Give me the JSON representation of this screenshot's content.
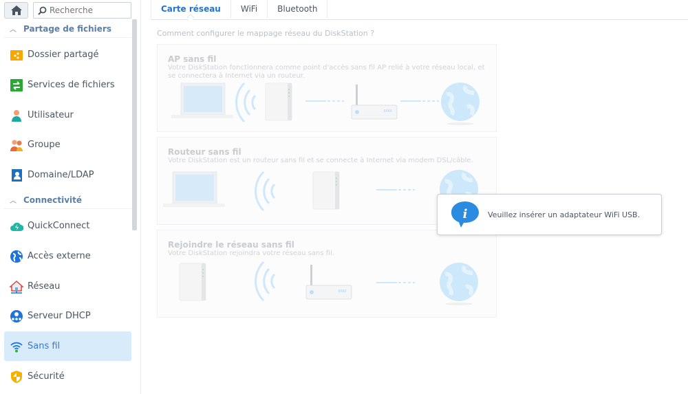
{
  "sidebar": {
    "search_placeholder": "Recherche",
    "sections": [
      {
        "label": "Partage de fichiers"
      },
      {
        "label": "Connectivité"
      }
    ],
    "items": [
      {
        "label": "Dossier partagé",
        "icon": "shared-folder-icon"
      },
      {
        "label": "Services de fichiers",
        "icon": "file-services-icon"
      },
      {
        "label": "Utilisateur",
        "icon": "user-icon"
      },
      {
        "label": "Groupe",
        "icon": "group-icon"
      },
      {
        "label": "Domaine/LDAP",
        "icon": "domain-ldap-icon"
      },
      {
        "label": "QuickConnect",
        "icon": "quickconnect-icon"
      },
      {
        "label": "Accès externe",
        "icon": "globe-icon"
      },
      {
        "label": "Réseau",
        "icon": "network-house-icon"
      },
      {
        "label": "Serveur DHCP",
        "icon": "dhcp-icon"
      },
      {
        "label": "Sans fil",
        "icon": "wifi-icon",
        "active": true
      },
      {
        "label": "Sécurité",
        "icon": "shield-icon"
      }
    ]
  },
  "tabs": [
    {
      "label": "Carte réseau",
      "active": true
    },
    {
      "label": "WiFi"
    },
    {
      "label": "Bluetooth"
    }
  ],
  "main": {
    "question": "Comment configurer le mappage réseau du DiskStation ?",
    "cards": [
      {
        "title": "AP sans fil",
        "desc": "Votre DiskStation fonctionnera comme point d'accès sans fil AP relié à votre réseau local, et se connectera à Internet via un routeur."
      },
      {
        "title": "Routeur sans fil",
        "desc": "Votre DiskStation est un routeur sans fil et se connecte à Internet via modem DSL/câble."
      },
      {
        "title": "Rejoindre le réseau sans fil",
        "desc": "Votre DiskStation rejoindra votre réseau sans fil."
      }
    ]
  },
  "tooltip": {
    "message": "Veuillez insérer un adaptateur WiFi USB."
  },
  "colors": {
    "accent": "#1f74d6",
    "active_bg": "#d8ebfb"
  }
}
